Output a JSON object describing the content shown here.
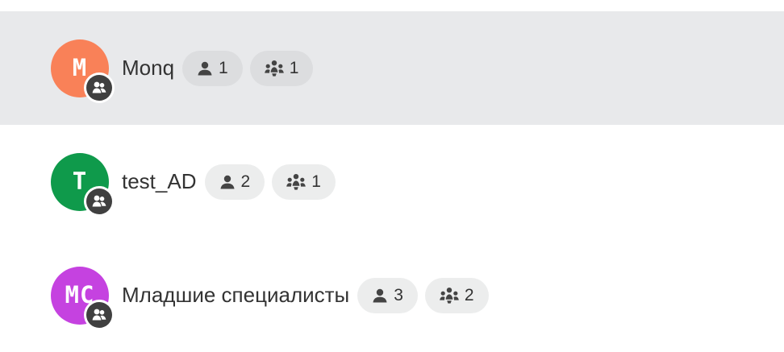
{
  "groups": [
    {
      "initials": "M",
      "name": "Monq",
      "avatar_color": "#f98158",
      "users_count": "1",
      "subgroups_count": "1",
      "selected": true
    },
    {
      "initials": "T",
      "name": "test_AD",
      "avatar_color": "#0f9a4b",
      "users_count": "2",
      "subgroups_count": "1",
      "selected": false
    },
    {
      "initials": "MC",
      "name": "Младшие специалисты",
      "avatar_color": "#c542e0",
      "users_count": "3",
      "subgroups_count": "2",
      "selected": false
    }
  ],
  "icons": {
    "avatar_badge": "group-badge-icon",
    "users_chip": "user-icon",
    "subgroups_chip": "team-icon"
  },
  "colors": {
    "selected_row_bg": "#e8e9eb",
    "chip_bg": "#eceded",
    "badge_bg": "#404040",
    "text": "#333333"
  }
}
